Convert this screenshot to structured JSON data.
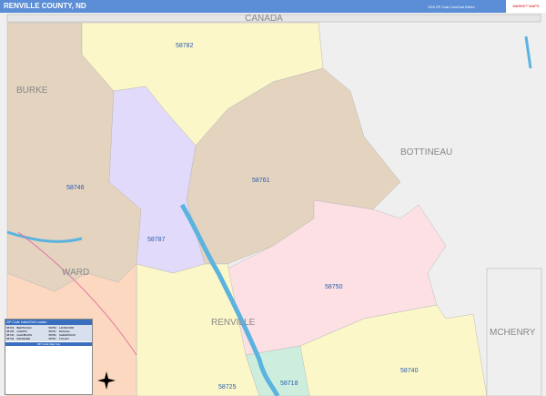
{
  "header": {
    "title": "RENVILLE COUNTY, ND",
    "edition": "2026 ZIP Code ColorCast Edition",
    "logo": "MARKET MAPS"
  },
  "map": {
    "country": "CANADA",
    "counties": [
      "BURKE",
      "BOTTINEAU",
      "WARD",
      "RENVILLE",
      "MCHENRY"
    ],
    "zips": [
      "58782",
      "58761",
      "58746",
      "58787",
      "58750",
      "58740",
      "58725",
      "58718"
    ],
    "colors": {
      "58782": "#fbf7c8",
      "58761": "#e3d3bf",
      "58746": "#e3d3bf",
      "58787": "#e2dafa",
      "58750": "#fde0e4",
      "58740": "#fbf7c8",
      "58725": "#fbf7c8",
      "58718": "#cdeedd",
      "ward": "#fbd8bf",
      "outside": "#efefef",
      "water": "#5bb3e0"
    }
  },
  "legend": {
    "title": "ZIP Code Index/Grid Locator",
    "entries": [
      {
        "zip": "58718",
        "name": "BERTHOLD"
      },
      {
        "zip": "58750",
        "name": "LANSFORD"
      },
      {
        "zip": "58725",
        "name": "CARPIO"
      },
      {
        "zip": "58761",
        "name": "MOHALL"
      },
      {
        "zip": "58740",
        "name": "GLENBURN"
      },
      {
        "zip": "58782",
        "name": "SHERWOOD"
      },
      {
        "zip": "58746",
        "name": "KENMARE"
      },
      {
        "zip": "58787",
        "name": "TOLLEY"
      }
    ],
    "key_title": "ZIP Code Map Key"
  }
}
